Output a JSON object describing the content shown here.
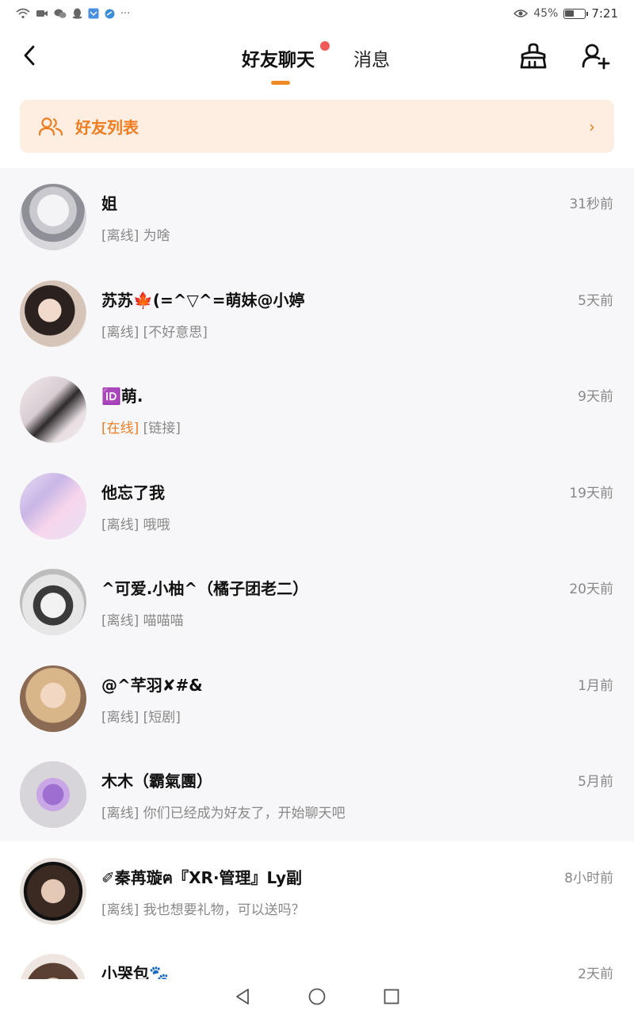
{
  "status_bar": {
    "battery_percent": "45%",
    "time": "7:21",
    "battery_level": 0.45,
    "icons": [
      "wifi-icon",
      "video-icon",
      "wechat-icon",
      "qq-icon",
      "app-icon",
      "app-icon",
      "more-icon"
    ]
  },
  "header": {
    "tabs": [
      {
        "label": "好友聊天",
        "active": true,
        "has_badge": true
      },
      {
        "label": "消息",
        "active": false,
        "has_badge": false
      }
    ],
    "accent_color": "#f08a24",
    "badge_color": "#f25a57"
  },
  "friend_list_banner": {
    "label": "好友列表",
    "arrow": "›"
  },
  "chats": [
    {
      "name": "姐",
      "time": "31秒前",
      "status": "[离线]",
      "message": "为啥",
      "online": false
    },
    {
      "name": "苏苏🍁(=^▽^=萌妹@小婷",
      "time": "5天前",
      "status": "[离线]",
      "message": "[不好意思]",
      "online": false
    },
    {
      "name": "🆔萌.",
      "time": "9天前",
      "status": "[在线]",
      "message": "[链接]",
      "online": true
    },
    {
      "name": "他忘了我",
      "time": "19天前",
      "status": "[离线]",
      "message": "哦哦",
      "online": false
    },
    {
      "name": "^可爱.小柚^（橘子团老二）",
      "time": "20天前",
      "status": "[离线]",
      "message": "喵喵喵",
      "online": false
    },
    {
      "name": "@^芊羽✘#&",
      "time": "1月前",
      "status": "[离线]",
      "message": "[短剧]",
      "online": false
    },
    {
      "name": "木木（霸氣團）",
      "time": "5月前",
      "status": "[离线]",
      "message": "你们已经成为好友了，开始聊天吧",
      "online": false
    },
    {
      "name": "✐秦苒璇ฅ『XR·管理』Ly副",
      "time": "8小时前",
      "status": "[离线]",
      "message": "我也想要礼物，可以送吗？",
      "online": false
    },
    {
      "name": "小哭包🐾",
      "time": "2天前",
      "status": "",
      "message": "",
      "online": false
    }
  ]
}
